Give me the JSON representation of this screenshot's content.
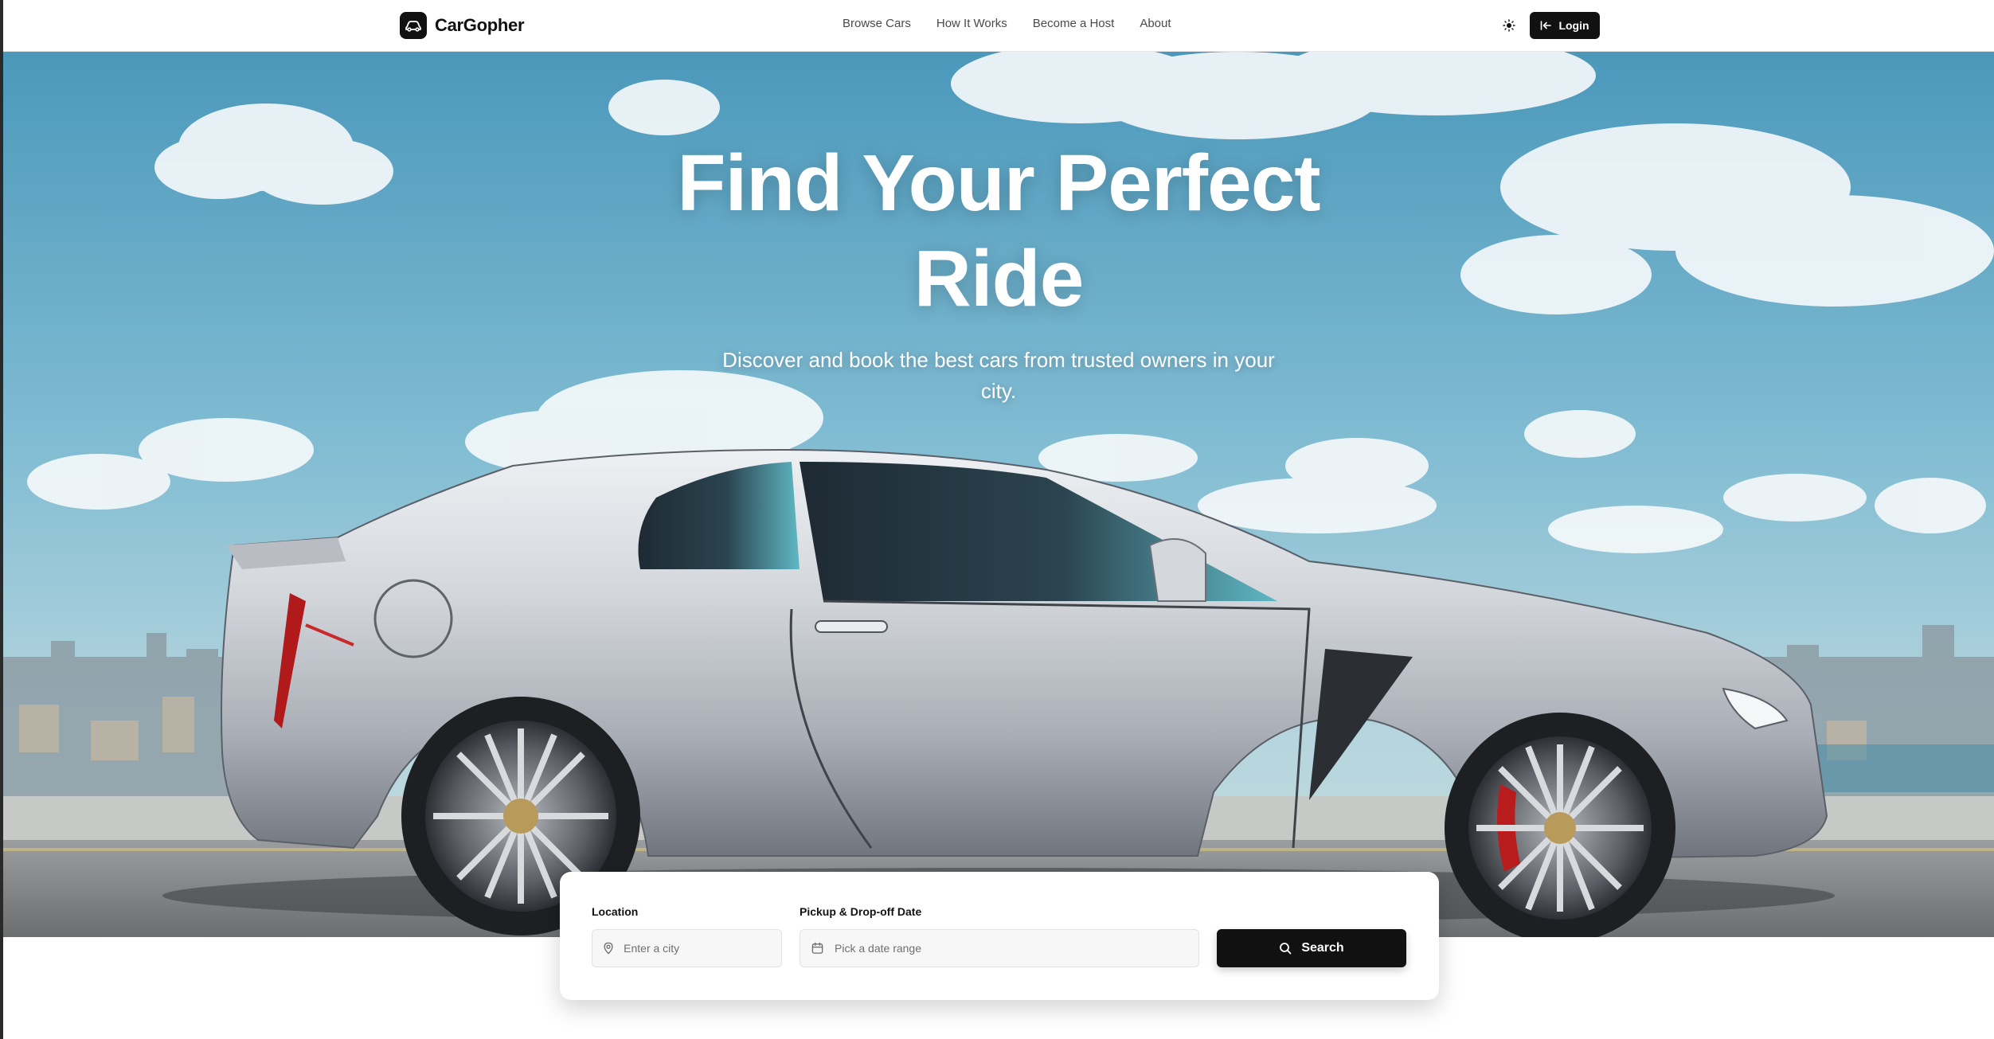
{
  "brand": {
    "name": "CarGopher",
    "logo_icon": "car-icon"
  },
  "nav": {
    "links": [
      {
        "label": "Browse Cars"
      },
      {
        "label": "How It Works"
      },
      {
        "label": "Become a Host"
      },
      {
        "label": "About"
      }
    ],
    "theme_icon": "sun-icon",
    "login_label": "Login",
    "login_icon": "login-arrow-icon"
  },
  "hero": {
    "title_line1": "Find Your Perfect",
    "title_line2": "Ride",
    "subtitle": "Discover and book the best cars from trusted owners in your city."
  },
  "search": {
    "location_label": "Location",
    "location_placeholder": "Enter a city",
    "location_value": "",
    "location_icon": "map-pin-icon",
    "date_label": "Pickup & Drop-off Date",
    "date_placeholder": "Pick a date range",
    "date_value": "",
    "date_icon": "calendar-icon",
    "button_label": "Search",
    "button_icon": "search-icon"
  },
  "colors": {
    "primary": "#111111",
    "sky": "#6fb0cc",
    "car": "#c9ccd1",
    "brake": "#b01a1a"
  }
}
